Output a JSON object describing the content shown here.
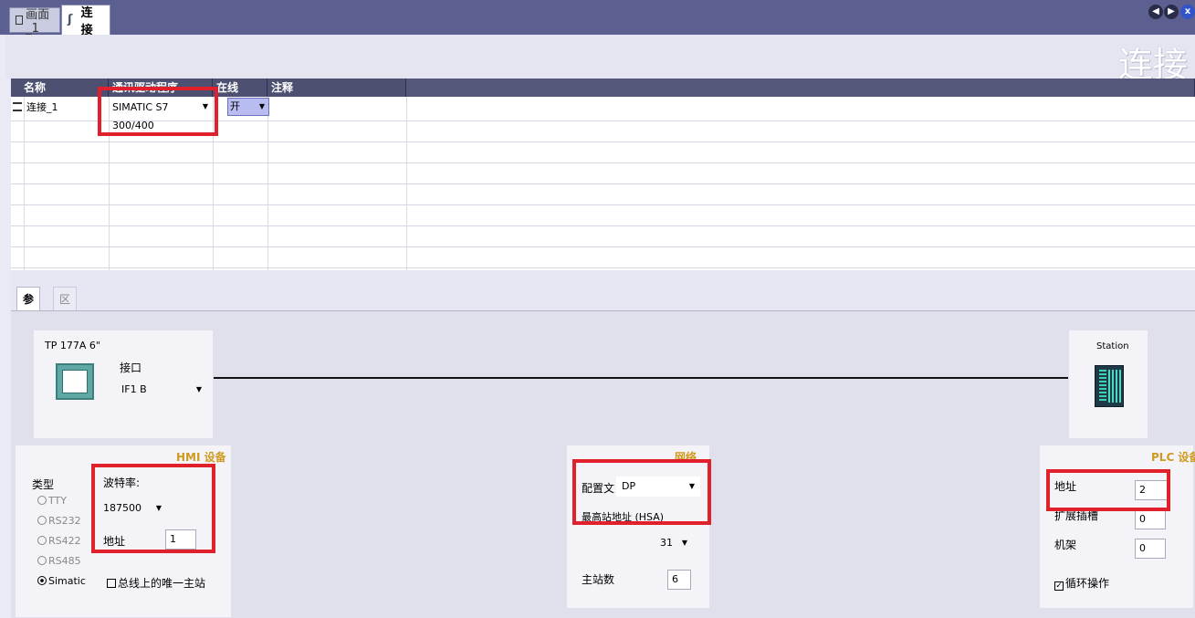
{
  "tabs": [
    {
      "label": "画面_1",
      "active": false
    },
    {
      "label": "连接",
      "active": true
    }
  ],
  "header": {
    "title": "连接"
  },
  "grid": {
    "columns": [
      "名称",
      "通讯驱动程序",
      "在线",
      "注释"
    ],
    "rows": [
      {
        "name": "连接_1",
        "driver": "SIMATIC S7 300/400",
        "online": "开",
        "comment": ""
      }
    ]
  },
  "subtabs": [
    "参数",
    "区域指针"
  ],
  "hmi_device": {
    "model": "TP 177A 6\"",
    "interface_label": "接口",
    "interface_value": "IF1 B",
    "section_title": "HMI 设备",
    "type_label": "类型",
    "types": [
      "TTY",
      "RS232",
      "RS422",
      "RS485",
      "Simatic"
    ],
    "selected_type": "Simatic",
    "baud_label": "波特率:",
    "baud_value": "187500",
    "address_label": "地址",
    "address_value": "1",
    "only_master_label": "总线上的唯一主站"
  },
  "network": {
    "section_title": "网络",
    "profile_label": "配置文",
    "profile_value": "DP",
    "highest_address_label": "最高站地址 (HSA)",
    "highest_address_value": "31",
    "masters_label": "主站数",
    "masters_value": "6"
  },
  "plc_device": {
    "station_label": "Station",
    "section_title": "PLC 设备",
    "address_label": "地址",
    "address_value": "2",
    "slot_label": "扩展插槽",
    "slot_value": "0",
    "rack_label": "机架",
    "rack_value": "0",
    "cyclic_label": "循环操作",
    "cyclic_checked": true
  },
  "colors": {
    "accent_red": "#e0202a",
    "header_dark": "#4d5070",
    "gold": "#d09a20"
  }
}
